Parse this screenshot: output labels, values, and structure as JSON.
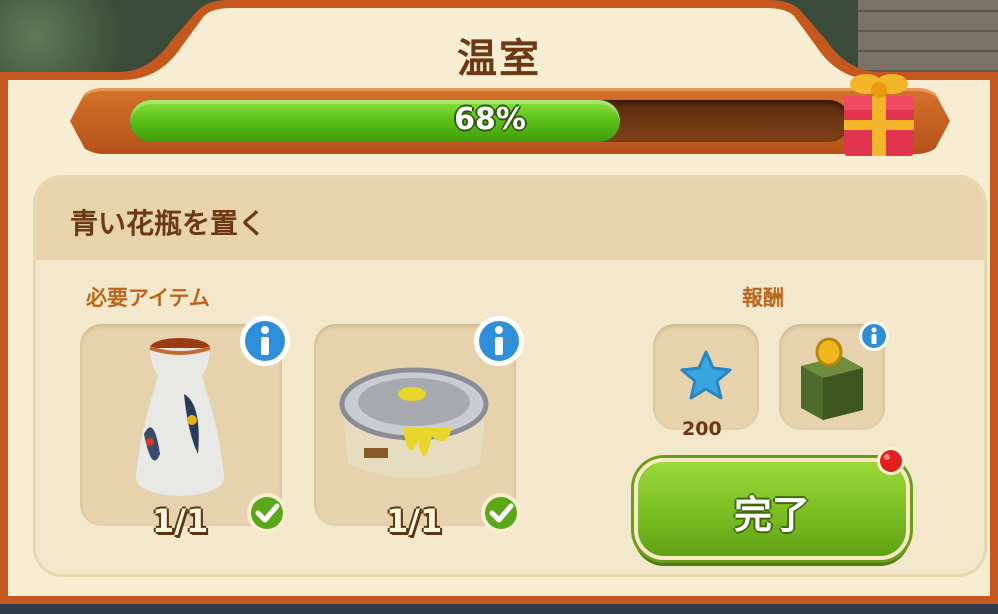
{
  "title": "温室",
  "progress": {
    "value": 0.68,
    "label": "68%"
  },
  "quest": {
    "title": "青い花瓶を置く",
    "required_label": "必要アイテム",
    "reward_label": "報酬",
    "required_items": [
      {
        "name": "blue-vase",
        "count": "1/1",
        "icon": "vase-icon",
        "done": true
      },
      {
        "name": "paint-can",
        "count": "1/1",
        "icon": "paint-can-icon",
        "done": true
      }
    ],
    "rewards": [
      {
        "icon": "blue-star-icon",
        "amount": "200"
      },
      {
        "icon": "coin-box-icon"
      }
    ],
    "complete_label": "完了"
  },
  "colors": {
    "accent": "#6b3a14",
    "progress": "#5fc21a",
    "button": "#7ec024",
    "notify": "#e02020"
  }
}
